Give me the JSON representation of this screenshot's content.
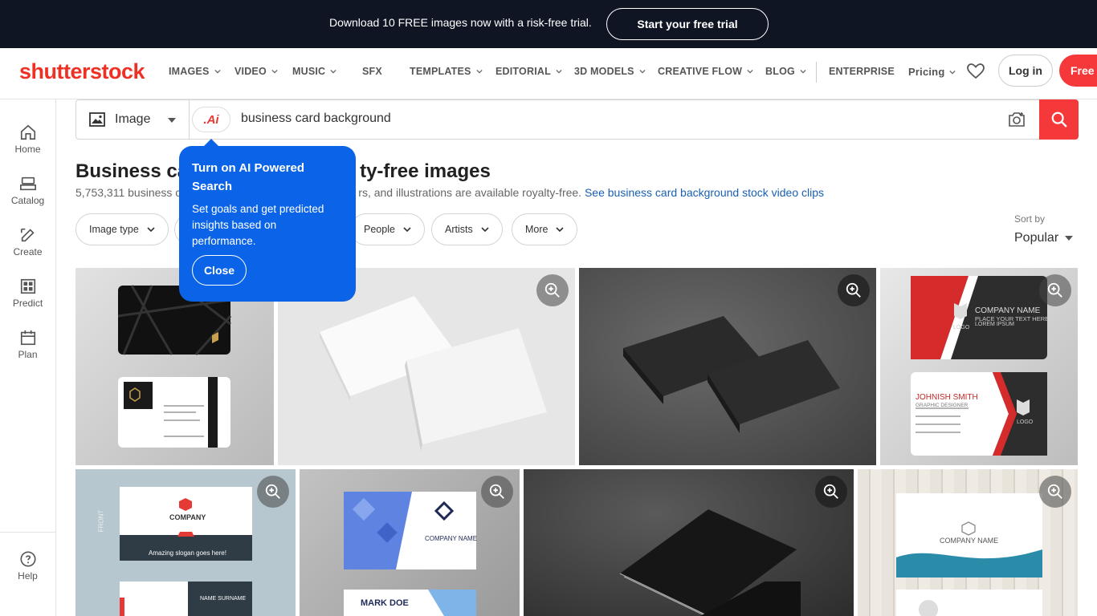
{
  "promo": {
    "text": "Download 10 FREE images now with a risk-free trial.",
    "cta": "Start your free trial"
  },
  "header": {
    "logo": "shutterstock",
    "nav": [
      "IMAGES",
      "VIDEO",
      "MUSIC",
      "SFX",
      "TEMPLATES",
      "EDITORIAL",
      "3D MODELS",
      "CREATIVE FLOW",
      "BLOG",
      "ENTERPRISE",
      "Pricing"
    ],
    "login": "Log in",
    "free_trial": "Free t"
  },
  "sidebar": {
    "items": [
      "Home",
      "Catalog",
      "Create",
      "Predict",
      "Plan"
    ],
    "help": "Help"
  },
  "search": {
    "type_label": "Image",
    "ai_label": ".Ai",
    "query": "business card background"
  },
  "results": {
    "title_left": "Business ca",
    "title_right": "ty-free images",
    "count_left": "5,753,311 business c",
    "count_right": "rs, and illustrations are available royalty-free.",
    "video_link": "See business card background stock video clips"
  },
  "filters": [
    "Image type",
    "People",
    "Artists",
    "More"
  ],
  "sort": {
    "label": "Sort by",
    "value": "Popular"
  },
  "popover": {
    "title": "Turn on AI Powered Search",
    "body": "Set goals and get predicted insights based on performance.",
    "close": "Close"
  },
  "cards": {
    "company_name": "COMPANY NAME",
    "company": "COMPANY",
    "company_name_2": "COMPANY NAME",
    "slogan": "Amazing slogan goes here!",
    "name_surname": "NAME SURNAME",
    "front": "FRONT",
    "logo": "LOGO",
    "place_text": "PLACE YOUR TEXT HERE",
    "lorem": "LOREM IPSUM",
    "johnish": "JOHNISH SMITH",
    "designer": "GRAPHIC DESIGNER",
    "mark_doe": "MARK DOE",
    "company_name_3": "COMPANY NAME",
    "company_name_4": "COMPANY NAME"
  },
  "colors": {
    "brand_red": "#f5393a",
    "promo_bg": "#0f1523",
    "popover_blue": "#0b64e8",
    "link_blue": "#1a5fb4"
  }
}
